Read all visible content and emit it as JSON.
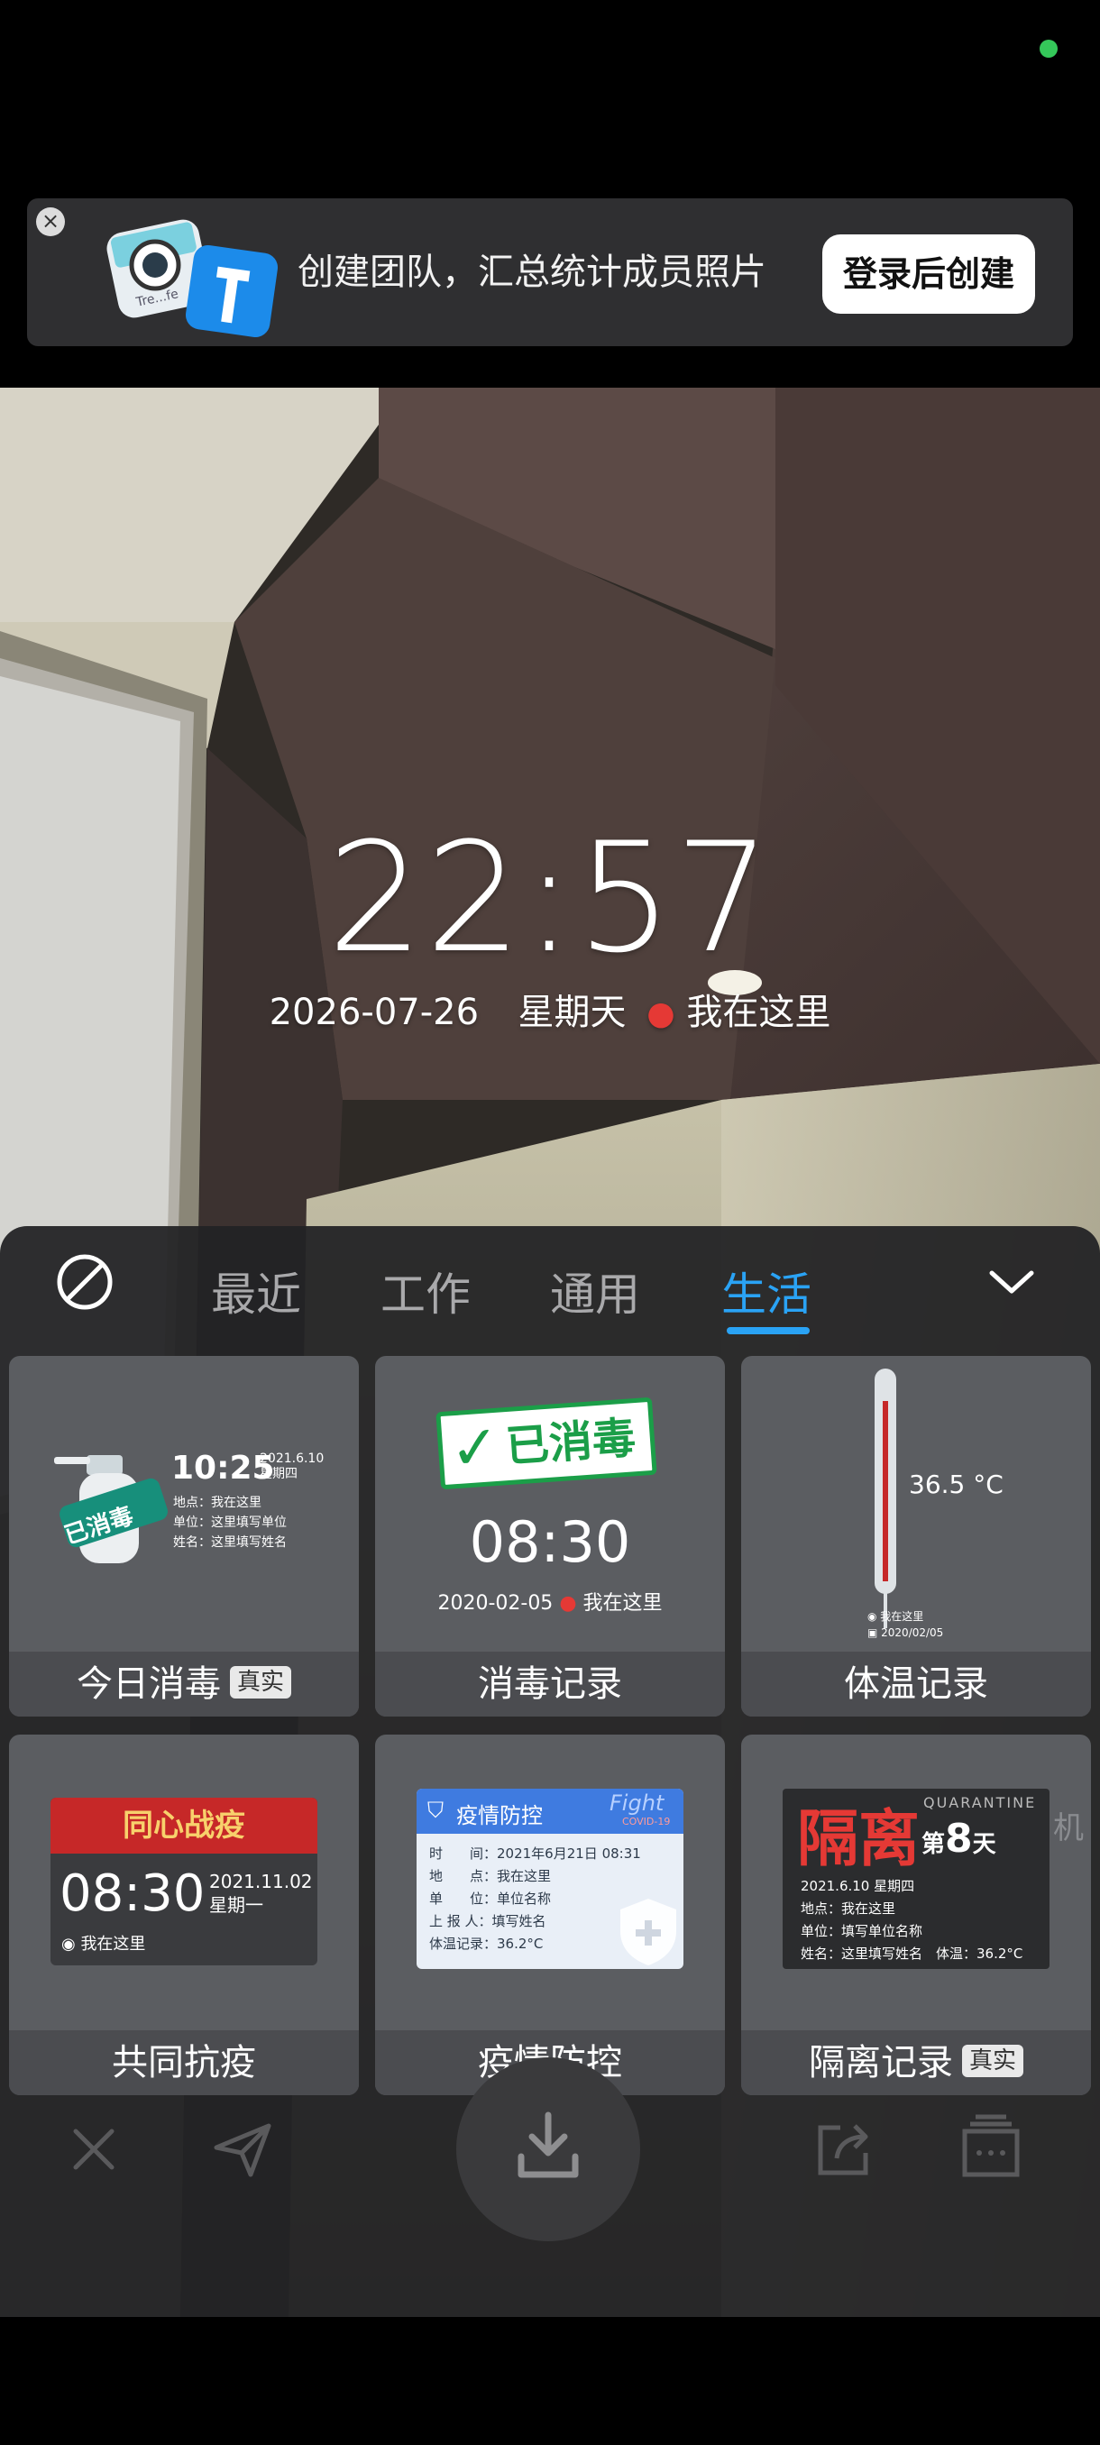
{
  "banner": {
    "close_label": "×",
    "text": "创建团队，汇总统计成员照片",
    "button_label": "登录后创建",
    "art_text": "Tre...fe"
  },
  "watermark": {
    "time": "22:57",
    "date": "2026-07-26",
    "weekday": "星期天",
    "location": "我在这里"
  },
  "tabs": [
    {
      "label": "最近",
      "active": false
    },
    {
      "label": "工作",
      "active": false
    },
    {
      "label": "通用",
      "active": false
    },
    {
      "label": "生活",
      "active": true
    }
  ],
  "cards": [
    {
      "title": "今日消毒",
      "tag": "真实",
      "preview": {
        "time": "10:25",
        "date": "2021.6.10",
        "weekday": "星期四",
        "stamp": "已消毒",
        "lines": [
          "地点：我在这里",
          "单位：这里填写单位",
          "姓名：这里填写姓名"
        ]
      }
    },
    {
      "title": "消毒记录",
      "preview": {
        "stamp": "已消毒",
        "time": "08:30",
        "date": "2020-02-05",
        "location": "我在这里"
      }
    },
    {
      "title": "体温记录",
      "preview": {
        "temp": "36.5 °C",
        "location": "我在这里",
        "date": "2020/02/05"
      }
    },
    {
      "title": "共同抗疫",
      "preview": {
        "banner": "同心战疫",
        "time": "08:30",
        "date": "2021.11.02",
        "weekday": "星期一",
        "location": "我在这里"
      }
    },
    {
      "title": "疫情防控",
      "preview": {
        "header": "疫情防控",
        "fight": "Fight",
        "covid": "COVID-19",
        "lines": [
          "时　　间：2021年6月21日 08:31",
          "地　　点：我在这里",
          "单　　位：单位名称",
          "上 报 人：填写姓名",
          "体温记录：36.2°C"
        ]
      }
    },
    {
      "title": "隔离记录",
      "tag": "真实",
      "preview": {
        "big": "隔离",
        "quarantine": "QUARANTINE",
        "day_prefix": "第",
        "day": "8",
        "day_suffix": "天",
        "lines": [
          "2021.6.10 星期四",
          "地点：我在这里",
          "单位：填写单位名称",
          "姓名：这里填写姓名　体温：36.2°C"
        ]
      }
    }
  ],
  "background_text": "机",
  "colors": {
    "accent": "#2aa3f5",
    "status_dot": "#35c85a"
  }
}
